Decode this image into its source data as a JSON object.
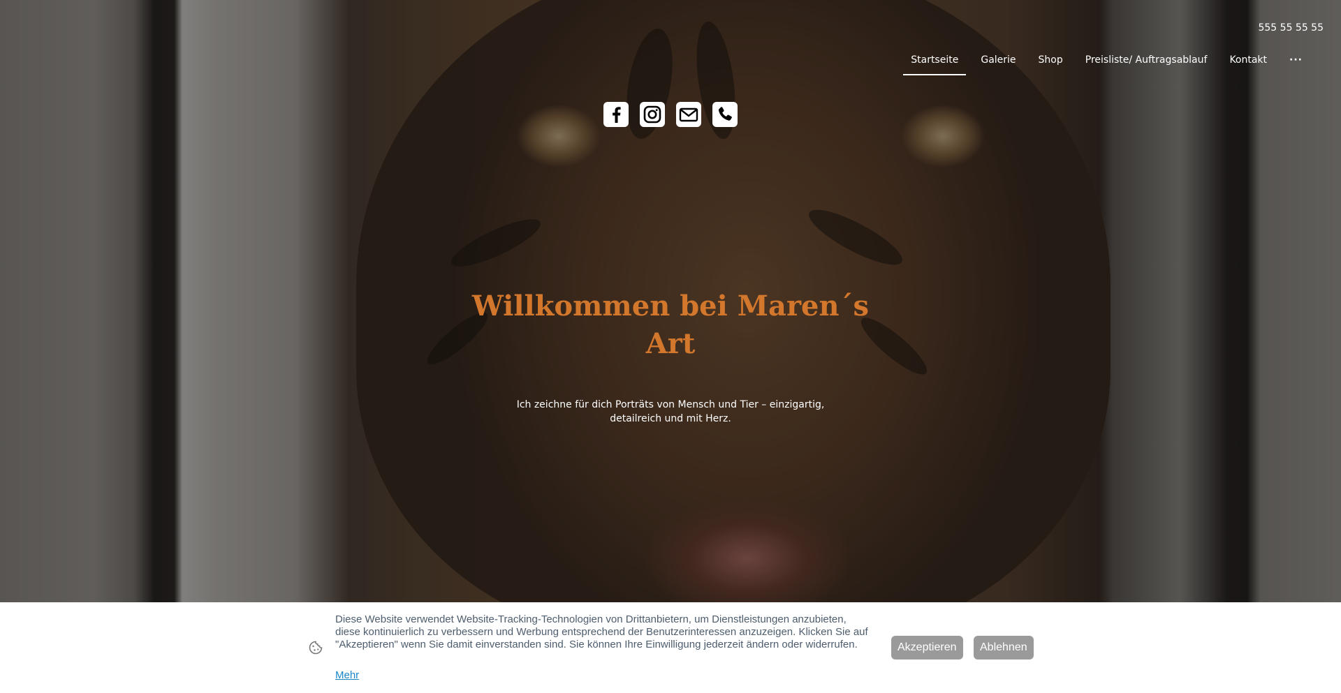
{
  "header": {
    "phone": "555 55 55 55",
    "nav": [
      {
        "label": "Startseite",
        "active": true
      },
      {
        "label": "Galerie",
        "active": false
      },
      {
        "label": "Shop",
        "active": false
      },
      {
        "label": "Preisliste/ Auftragsablauf",
        "active": false
      },
      {
        "label": "Kontakt",
        "active": false
      },
      {
        "label": "···",
        "active": false
      }
    ]
  },
  "social": {
    "icons": [
      "facebook-icon",
      "instagram-icon",
      "mail-icon",
      "phone-icon"
    ]
  },
  "hero": {
    "title_line1": "Willkommen bei Maren´s",
    "title_line2": "Art",
    "subtitle_line1": "Ich zeichne für dich Porträts von Mensch und Tier – einzigartig,",
    "subtitle_line2": "detailreich und mit Herz."
  },
  "cookie_banner": {
    "text": "Diese Website verwendet Website-Tracking-Technologien von Drittanbietern, um Dienstleistungen anzubieten, diese kontinuierlich zu verbessern und Werbung entsprechend der Benutzerinteressen anzuzeigen. Klicken Sie auf \"Akzeptieren\" wenn Sie damit einverstanden sind. Sie können Ihre Einwilligung jederzeit ändern oder widerrufen.",
    "more_link": "Mehr",
    "accept_label": "Akzeptieren",
    "decline_label": "Ablehnen"
  },
  "colors": {
    "title": "#d2772c",
    "button_gray": "#9a9a9a",
    "link_blue": "#1a86c8"
  }
}
